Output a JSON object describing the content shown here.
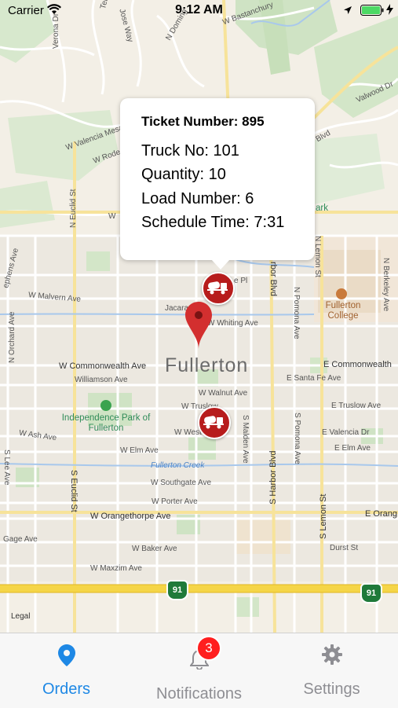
{
  "status_bar": {
    "carrier": "Carrier",
    "time": "9:12 AM"
  },
  "map": {
    "city_label": "Fullerton",
    "legal": "Legal",
    "route_shield": "91",
    "streets": {
      "w_bastanchury": "W Bastanchury",
      "valwood": "Valwood Dr",
      "blvd": "Blvd",
      "w_valencia_mesa": "W Valencia Mesa",
      "w_rode": "W Rode",
      "n_euclid": "N Euclid St",
      "terraza": "Terraza Dr",
      "jose_way": "Jose Way",
      "verona": "Verona Dr",
      "n_domingo": "N Doming",
      "w_street": "W",
      "ephens": "ephens Ave",
      "w_malvern": "W Malvern Ave",
      "n_orchard": "N Orchard Ave",
      "jacaranda": "Jacaran",
      "dale_pl": "e Pl",
      "w_whiting": "W Whiting Ave",
      "w_commonwealth": "W Commonwealth Ave",
      "e_commonwealth": "E Commonwealth",
      "williamson": "Williamson Ave",
      "w_walnut": "W Walnut Ave",
      "e_santa_fe": "E Santa Fe Ave",
      "w_truslow": "W Truslow",
      "e_truslow": "E Truslow Ave",
      "w_ash": "W Ash Ave",
      "w_west": "W West Ave",
      "e_valencia": "E Valencia Dr",
      "w_elm": "W Elm Ave",
      "s_malden": "S Malden Ave",
      "s_pomona": "S Pomona Ave",
      "e_elm": "E Elm Ave",
      "s_lee": "S Lee Ave",
      "s_euclid": "S Euclid St",
      "w_southgate": "W Southgate Ave",
      "s_harbor": "S Harbor Blvd",
      "s_lemon": "S Lemon St",
      "w_porter": "W Porter Ave",
      "w_orangethorpe": "W Orangethorpe Ave",
      "e_orange": "E Orang",
      "gage": "Gage Ave",
      "w_baker": "W Baker Ave",
      "durst": "Durst St",
      "w_maxzim": "W Maxzim Ave",
      "harbor_blvd_n": "rbor Blvd",
      "n_pomona": "N Pomona Ave",
      "n_lemon": "N Lemon St",
      "n_berkeley": "N Berkeley Ave",
      "park": "ark",
      "e_label": "E"
    },
    "poi": {
      "independence_park": "Independence Park of Fullerton",
      "fullerton_college": "Fullerton College",
      "fullerton_creek": "Fullerton Creek"
    }
  },
  "callout": {
    "title": "Ticket Number: 895",
    "truck_no": "Truck No: 101",
    "quantity": "Quantity: 10",
    "load_number": "Load Number: 6",
    "schedule_time": "Schedule Time: 7:31"
  },
  "tabbar": {
    "orders": "Orders",
    "notifications": "Notifications",
    "notifications_badge": "3",
    "settings": "Settings",
    "active_color": "#1e88e5",
    "inactive_color": "#8e8e93"
  },
  "colors": {
    "truck_marker": "#b71c1c",
    "pin": "#d32f2f",
    "badge": "#ff1e1e",
    "freeway": "#f5d547"
  }
}
